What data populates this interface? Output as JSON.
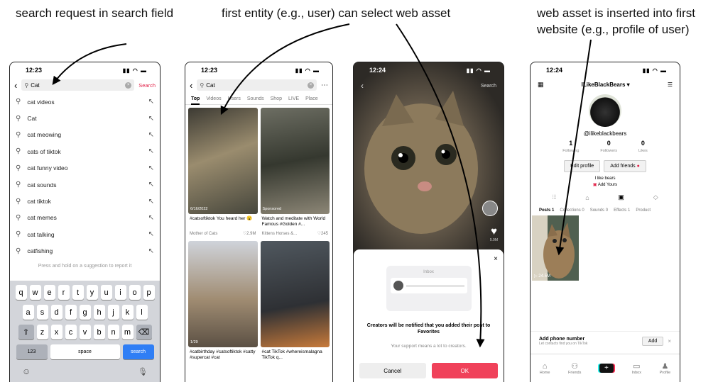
{
  "captions": {
    "c1": "search request in search field",
    "c2": "first entity (e.g., user) can select web asset",
    "c3_line1": "web asset is inserted into first",
    "c3_line2": "website (e.g., profile of user)"
  },
  "phone1": {
    "time": "12:23",
    "query": "Cat",
    "search_label": "Search",
    "suggestions": [
      "cat videos",
      "Cat",
      "cat meowing",
      "cats of tiktok",
      "cat funny video",
      "cat sounds",
      "cat tiktok",
      "cat memes",
      "cat talking",
      "catfishing"
    ],
    "hint": "Press and hold on a suggestion to report it",
    "kb_row1": [
      "q",
      "w",
      "e",
      "r",
      "t",
      "y",
      "u",
      "i",
      "o",
      "p"
    ],
    "kb_row2": [
      "a",
      "s",
      "d",
      "f",
      "g",
      "h",
      "j",
      "k",
      "l"
    ],
    "kb_row3": [
      "z",
      "x",
      "c",
      "v",
      "b",
      "n",
      "m"
    ],
    "kb_123": "123",
    "kb_space": "space",
    "kb_search": "search"
  },
  "phone2": {
    "time": "12:23",
    "query": "Cat",
    "tabs": [
      "Top",
      "Videos",
      "Users",
      "Sounds",
      "Shop",
      "LIVE",
      "Place"
    ],
    "results": [
      {
        "caption": "#catsoftiktok You heard her 😮",
        "author": "Mother of Cats",
        "likes": "♡2.9M",
        "badge": "6/16/2022"
      },
      {
        "caption": "Watch and meditate with World Famous #Golden #...",
        "author": "Kittens Horses &...",
        "likes": "♡245",
        "badge": "Sponsored"
      },
      {
        "caption": "#catbirthday #catsoftiktok #catty #supercat #cat",
        "author": "",
        "likes": "",
        "badge": "1/29"
      },
      {
        "caption": "#cat TikTok #whereismalagna TikTok q...",
        "author": "",
        "likes": "",
        "badge": ""
      }
    ]
  },
  "phone3": {
    "time": "12:24",
    "search_label": "Search",
    "side_count": "5.9M",
    "inbox_label": "Inbox",
    "message": "Creators will be notified that you added their post to Favorites",
    "sub": "Your support means a lot to creators.",
    "cancel": "Cancel",
    "ok": "OK"
  },
  "phone4": {
    "time": "12:24",
    "username": "ILikeBlackBears",
    "handle": "@ilikeblackbears",
    "stats": [
      {
        "n": "1",
        "l": "Following"
      },
      {
        "n": "0",
        "l": "Followers"
      },
      {
        "n": "0",
        "l": "Likes"
      }
    ],
    "edit_profile": "Edit profile",
    "add_friends": "Add friends",
    "bio": "I like bears",
    "add_yours": "Add Yours",
    "tabs": [
      "Posts 1",
      "Collections 0",
      "Sounds 0",
      "Effects 1",
      "Product"
    ],
    "post_views": "24.5M",
    "phone_title": "Add phone number",
    "phone_sub": "Let contacts find you on TikTok",
    "add": "Add",
    "nav": [
      "Home",
      "Friends",
      "",
      "Inbox",
      "Profile"
    ]
  }
}
